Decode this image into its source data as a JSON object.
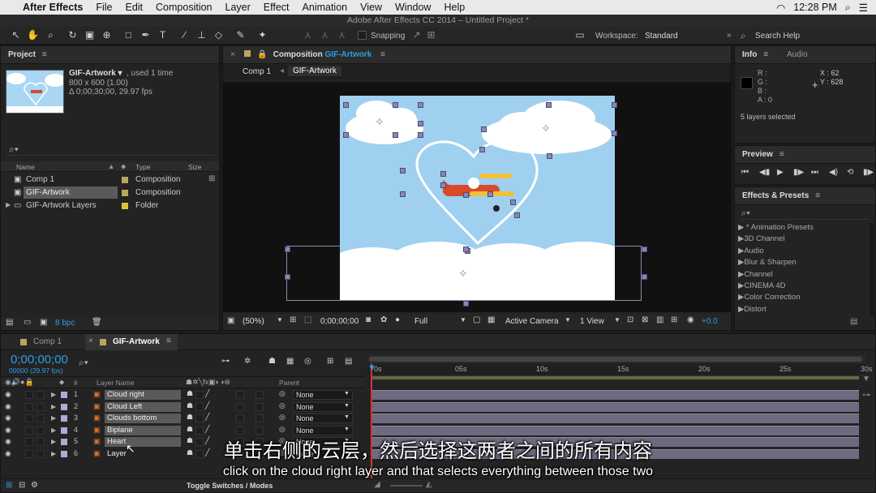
{
  "menubar": {
    "app": "After Effects",
    "items": [
      "File",
      "Edit",
      "Composition",
      "Layer",
      "Effect",
      "Animation",
      "View",
      "Window",
      "Help"
    ],
    "clock": "12:28 PM"
  },
  "titlebar": "Adobe After Effects CC 2014 – Untitled Project *",
  "toolbar": {
    "snapping": "Snapping",
    "workspace_label": "Workspace:",
    "workspace_value": "Standard",
    "search_help": "Search Help"
  },
  "project": {
    "tab": "Project",
    "item_name": "GIF-Artwork ▾",
    "used": ", used 1 time",
    "dims": "800 x 600 (1.00)",
    "duration": "Δ 0;00;30;00, 29.97 fps",
    "cols": {
      "name": "Name",
      "type": "Type",
      "size": "Size"
    },
    "items": [
      {
        "name": "Comp 1",
        "type": "Composition",
        "color": "#b9a75a"
      },
      {
        "name": "GIF-Artwork",
        "type": "Composition",
        "color": "#b9a75a"
      },
      {
        "name": "GIF-Artwork Layers",
        "type": "Folder",
        "color": "#d9c437"
      }
    ],
    "bpc": "8 bpc"
  },
  "comp": {
    "tab_prefix": "Composition",
    "tab_name": "GIF-Artwork",
    "crumbs": [
      "Comp 1",
      "GIF-Artwork"
    ],
    "zoom": "(50%)",
    "timecode": "0;00;00;00",
    "resolution": "Full",
    "camera": "Active Camera",
    "view": "1 View",
    "exposure": "+0.0"
  },
  "info": {
    "tabs": [
      "Info",
      "Audio"
    ],
    "r": "R :",
    "g": "G :",
    "b": "B :",
    "a": "A : 0",
    "x": "X : 62",
    "y": "Y : 628",
    "selected": "5 layers selected"
  },
  "preview": {
    "tab": "Preview"
  },
  "effects": {
    "tab": "Effects & Presets",
    "items": [
      "* Animation Presets",
      "3D Channel",
      "Audio",
      "Blur & Sharpen",
      "Channel",
      "CINEMA 4D",
      "Color Correction",
      "Distort"
    ]
  },
  "timeline": {
    "tabs": [
      "Comp 1",
      "GIF-Artwork"
    ],
    "timecode": "0;00;00;00",
    "frames": "00000 (29.97 fps)",
    "col_layer_name": "Layer Name",
    "col_parent": "Parent",
    "col_num": "#",
    "ruler": [
      "0s",
      "05s",
      "10s",
      "15s",
      "20s",
      "25s",
      "30s"
    ],
    "layers": [
      {
        "num": "1",
        "name": "Cloud right",
        "parent": "None"
      },
      {
        "num": "2",
        "name": "Cloud Left",
        "parent": "None"
      },
      {
        "num": "3",
        "name": "Clouds bottom",
        "parent": "None"
      },
      {
        "num": "4",
        "name": "Biplane",
        "parent": "None"
      },
      {
        "num": "5",
        "name": "Heart",
        "parent": "None"
      },
      {
        "num": "6",
        "name": "Layer",
        "parent": "None"
      }
    ],
    "toggle": "Toggle Switches / Modes"
  },
  "subtitles": {
    "cn": "单击右侧的云层，然后选择这两者之间的所有内容",
    "en": "click on the cloud right layer and that selects everything between those two"
  },
  "colors": {
    "accent": "#2d9ee3",
    "sky": "#9fd0f0",
    "layer_label": "#b3a8d6"
  }
}
